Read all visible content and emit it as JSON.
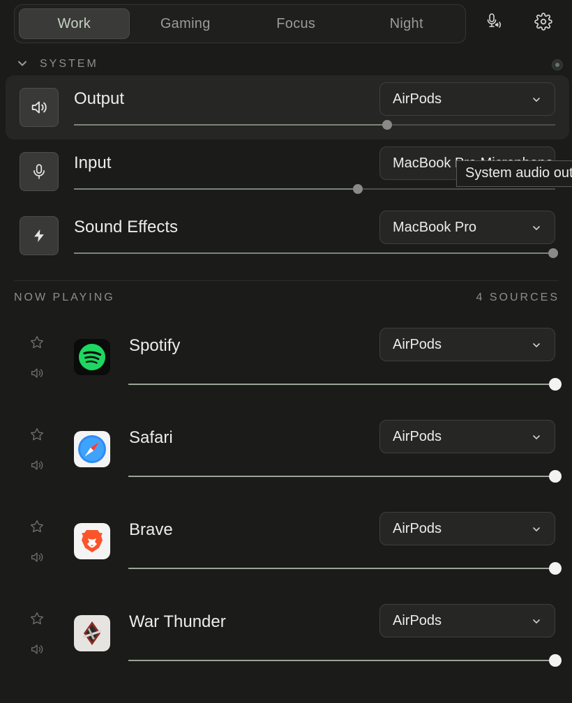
{
  "profiles": {
    "tabs": [
      "Work",
      "Gaming",
      "Focus",
      "Night"
    ],
    "active": "Work"
  },
  "toolbar": {
    "mic_icon": "mic-broadcast-icon",
    "settings_icon": "gear-icon"
  },
  "system": {
    "heading": "SYSTEM",
    "rows": [
      {
        "label": "Output",
        "device": "AirPods",
        "icon": "speaker-icon",
        "volume": 0.65,
        "highlighted": true
      },
      {
        "label": "Input",
        "device": "MacBook Pro Microphone",
        "icon": "microphone-icon",
        "volume": 0.59,
        "highlighted": false
      },
      {
        "label": "Sound Effects",
        "device": "MacBook Pro",
        "icon": "bolt-icon",
        "volume": 1.0,
        "highlighted": false
      }
    ],
    "tooltip": "System audio output"
  },
  "now_playing": {
    "heading": "NOW PLAYING",
    "count_label": "4 SOURCES",
    "apps": [
      {
        "name": "Spotify",
        "device": "AirPods",
        "icon": "spotify-icon",
        "volume": 1.0
      },
      {
        "name": "Safari",
        "device": "AirPods",
        "icon": "safari-icon",
        "volume": 1.0
      },
      {
        "name": "Brave",
        "device": "AirPods",
        "icon": "brave-icon",
        "volume": 1.0
      },
      {
        "name": "War Thunder",
        "device": "AirPods",
        "icon": "war-thunder-icon",
        "volume": 1.0
      }
    ]
  },
  "colors": {
    "background": "#1b1b1a",
    "accent": "#7b8777",
    "spotify": "#1ed760",
    "brave": "#fb542b"
  }
}
